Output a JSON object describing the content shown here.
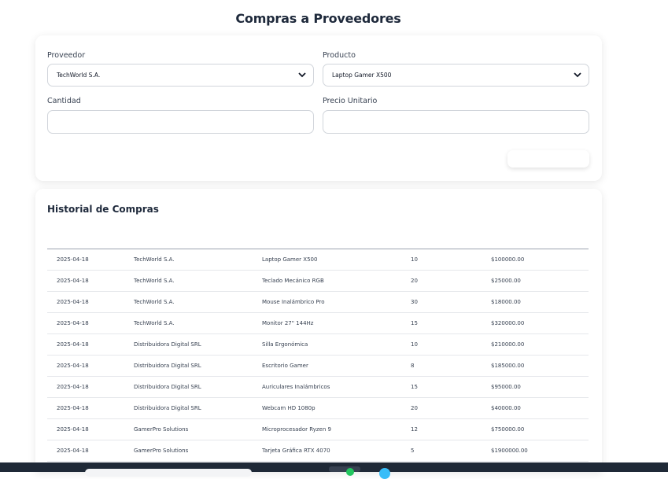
{
  "page": {
    "title": "Compras a Proveedores"
  },
  "form": {
    "proveedor_label": "Proveedor",
    "proveedor_value": "TechWorld S.A.",
    "producto_label": "Producto",
    "producto_value": "Laptop Gamer X500",
    "cantidad_label": "Cantidad",
    "cantidad_value": "",
    "precio_label": "Precio Unitario",
    "precio_value": "",
    "submit_label": ""
  },
  "history": {
    "title": "Historial de Compras",
    "rows": [
      {
        "fecha": "2025-04-18",
        "proveedor": "TechWorld S.A.",
        "producto": "Laptop Gamer X500",
        "cantidad": "10",
        "total": "$100000.00"
      },
      {
        "fecha": "2025-04-18",
        "proveedor": "TechWorld S.A.",
        "producto": "Teclado Mecánico RGB",
        "cantidad": "20",
        "total": "$25000.00"
      },
      {
        "fecha": "2025-04-18",
        "proveedor": "TechWorld S.A.",
        "producto": "Mouse Inalámbrico Pro",
        "cantidad": "30",
        "total": "$18000.00"
      },
      {
        "fecha": "2025-04-18",
        "proveedor": "TechWorld S.A.",
        "producto": "Monitor 27\" 144Hz",
        "cantidad": "15",
        "total": "$320000.00"
      },
      {
        "fecha": "2025-04-18",
        "proveedor": "Distribuidora Digital SRL",
        "producto": "Silla Ergonómica",
        "cantidad": "10",
        "total": "$210000.00"
      },
      {
        "fecha": "2025-04-18",
        "proveedor": "Distribuidora Digital SRL",
        "producto": "Escritorio Gamer",
        "cantidad": "8",
        "total": "$185000.00"
      },
      {
        "fecha": "2025-04-18",
        "proveedor": "Distribuidora Digital SRL",
        "producto": "Auriculares Inalámbricos",
        "cantidad": "15",
        "total": "$95000.00"
      },
      {
        "fecha": "2025-04-18",
        "proveedor": "Distribuidora Digital SRL",
        "producto": "Webcam HD 1080p",
        "cantidad": "20",
        "total": "$40000.00"
      },
      {
        "fecha": "2025-04-18",
        "proveedor": "GamerPro Solutions",
        "producto": "Microprocesador Ryzen 9",
        "cantidad": "12",
        "total": "$750000.00"
      },
      {
        "fecha": "2025-04-18",
        "proveedor": "GamerPro Solutions",
        "producto": "Tarjeta Gráfica RTX 4070",
        "cantidad": "5",
        "total": "$1900000.00"
      }
    ]
  },
  "icons": {
    "select_arrow": "chevron-down-icon"
  }
}
